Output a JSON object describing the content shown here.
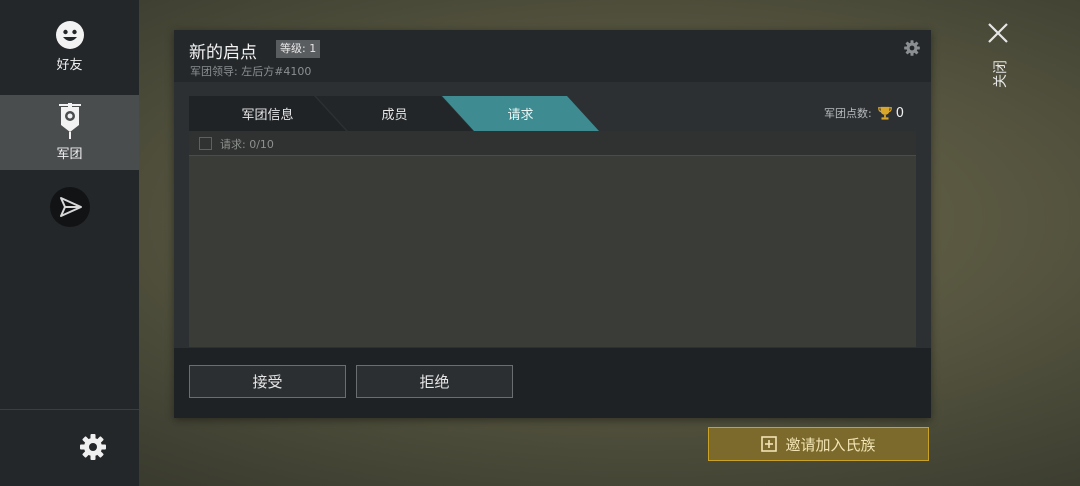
{
  "sidebar": {
    "friends_label": "好友",
    "clan_label": "军团"
  },
  "panel": {
    "clan_name": "新的启点",
    "level_label": "等级: 1",
    "leader_prefix": "军团领导: ",
    "leader_name": "左后方#4100",
    "tabs": [
      {
        "label": "军团信息",
        "active": false
      },
      {
        "label": "成员",
        "active": false
      },
      {
        "label": "请求",
        "active": true
      }
    ],
    "points_label": "军团点数:",
    "points_value": "0",
    "requests_count": "请求: 0/10",
    "accept_label": "接受",
    "reject_label": "拒绝"
  },
  "invite_label": "邀请加入氏族",
  "close_label": "关闭",
  "colors": {
    "active_tab": "#3e8c91",
    "invite_border": "#c9a227",
    "trophy": "#d9a52b"
  },
  "icons": [
    "friends-face-icon",
    "clan-banner-icon",
    "send-icon",
    "settings-gear-icon",
    "trophy-icon",
    "plus-box-icon",
    "close-icon"
  ]
}
